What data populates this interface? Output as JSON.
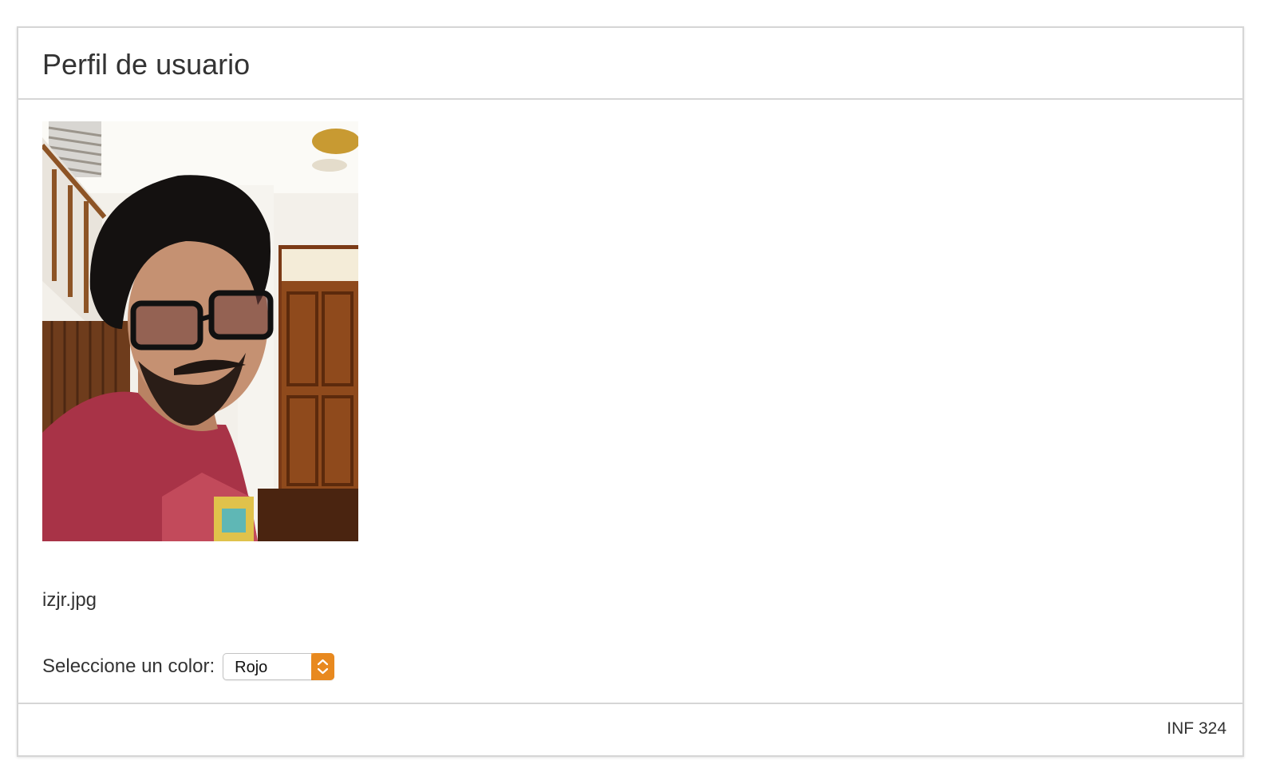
{
  "panel": {
    "title": "Perfil de usuario"
  },
  "profile": {
    "photo_name": "profile-photo",
    "file_name": "izjr.jpg"
  },
  "color_select": {
    "label": "Seleccione un color:",
    "value": "Rojo",
    "accent_color": "#e8891f"
  },
  "footer": {
    "code": "INF 324"
  },
  "icons": {
    "select_arrows": "chevron-up-down-icon"
  }
}
